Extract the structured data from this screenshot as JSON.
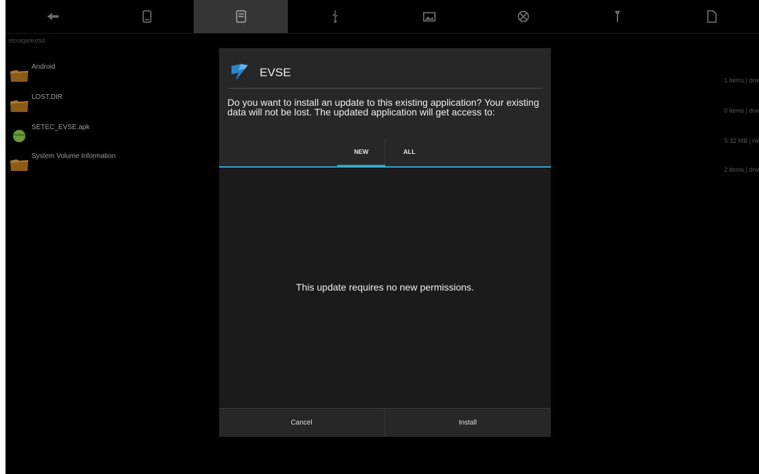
{
  "toolbar": {
    "items": [
      {
        "icon": "back-arrow-icon"
      },
      {
        "icon": "phone-storage-icon"
      },
      {
        "icon": "sd-card-icon",
        "active": true
      },
      {
        "icon": "usb-icon"
      },
      {
        "icon": "image-icon"
      },
      {
        "icon": "network-icon"
      },
      {
        "icon": "tool-icon"
      },
      {
        "icon": "file-icon"
      }
    ]
  },
  "path": "storage/extsd",
  "files": [
    {
      "name": "Android",
      "icon": "folder-icon",
      "meta": "1 items | drw"
    },
    {
      "name": "LOST.DIR",
      "icon": "folder-icon",
      "meta": "0 items | drw"
    },
    {
      "name": "SETEC_EVSE.apk",
      "icon": "android-apk-icon",
      "meta": "5.32 MB | rw"
    },
    {
      "name": "System Volume Information",
      "icon": "folder-icon",
      "meta": "2 items | drw"
    }
  ],
  "dialog": {
    "title": "EVSE",
    "message": "Do you want to install an update to this existing application? Your existing data will not be lost. The updated application will get access to:",
    "tabs": {
      "new": "NEW",
      "all": "ALL"
    },
    "content": "This update requires no new permissions.",
    "cancel": "Cancel",
    "install": "Install"
  },
  "colors": {
    "accent": "#2fa7cf",
    "background": "#000000",
    "dialog": "#272727"
  }
}
